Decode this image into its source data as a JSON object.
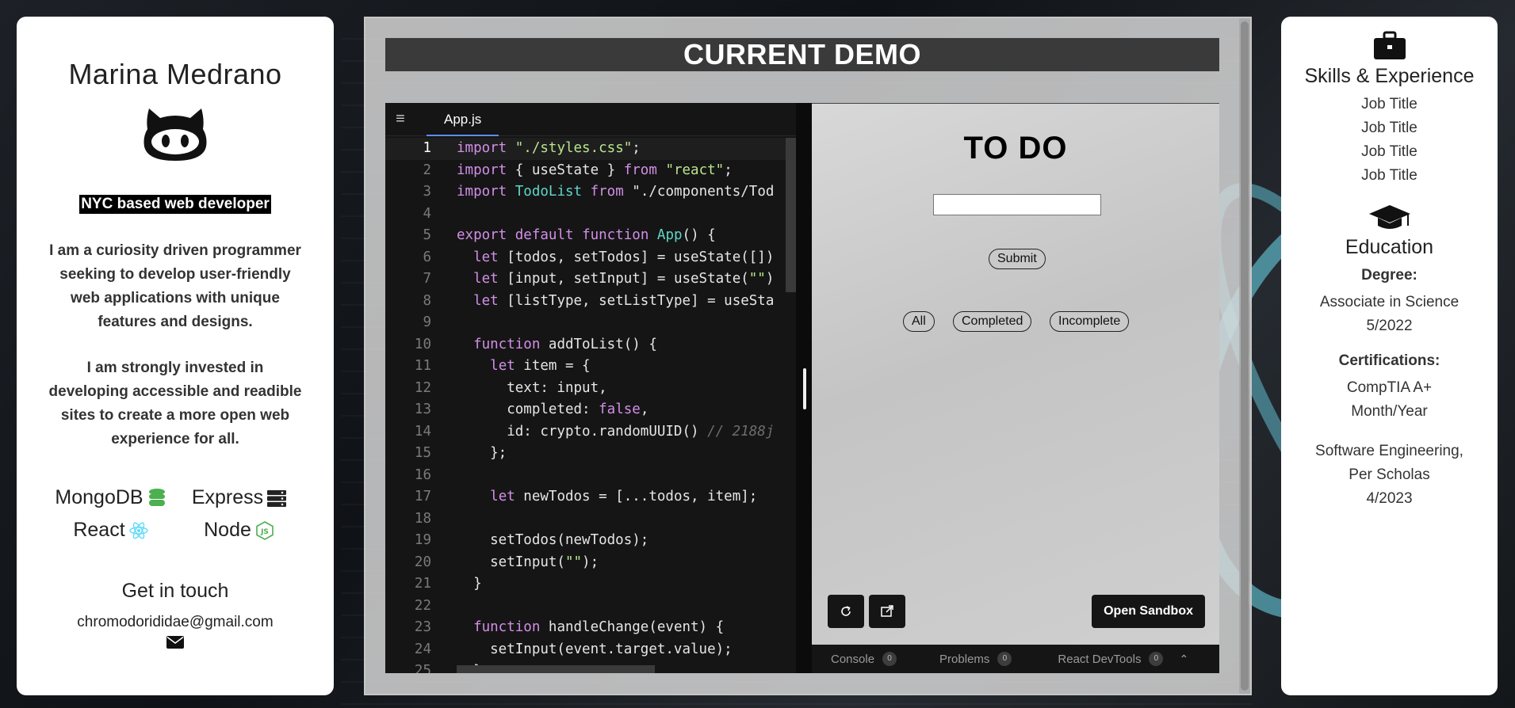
{
  "profile": {
    "name": "Marina Medrano",
    "tagline": "NYC based web developer",
    "bio_1": "I am a curiosity driven programmer seeking to develop user-friendly web applications with unique features and designs.",
    "bio_2": "I am strongly invested in developing accessible and readible sites to create a more open web experience for all.",
    "tech": [
      {
        "label": "MongoDB",
        "icon": "database-icon",
        "color": "#4caf50"
      },
      {
        "label": "Express",
        "icon": "server-icon",
        "color": "#222222"
      },
      {
        "label": "React",
        "icon": "react-icon",
        "color": "#61dafb"
      },
      {
        "label": "Node",
        "icon": "nodejs-icon",
        "color": "#4caf50"
      }
    ],
    "contact_heading": "Get in touch",
    "email": "chromodorididae@gmail.com"
  },
  "demo": {
    "title": "CURRENT DEMO",
    "tab_label": "App.js",
    "code_lines": [
      {
        "n": "1",
        "t": "import \"./styles.css\";"
      },
      {
        "n": "2",
        "t": "import { useState } from \"react\";"
      },
      {
        "n": "3",
        "t": "import TodoList from \"./components/Tod"
      },
      {
        "n": "4",
        "t": ""
      },
      {
        "n": "5",
        "t": "export default function App() {"
      },
      {
        "n": "6",
        "t": "  let [todos, setTodos] = useState([])"
      },
      {
        "n": "7",
        "t": "  let [input, setInput] = useState(\"\")"
      },
      {
        "n": "8",
        "t": "  let [listType, setListType] = useSta"
      },
      {
        "n": "9",
        "t": ""
      },
      {
        "n": "10",
        "t": "  function addToList() {"
      },
      {
        "n": "11",
        "t": "    let item = {"
      },
      {
        "n": "12",
        "t": "      text: input,"
      },
      {
        "n": "13",
        "t": "      completed: false,"
      },
      {
        "n": "14",
        "t": "      id: crypto.randomUUID() // 2188j"
      },
      {
        "n": "15",
        "t": "    };"
      },
      {
        "n": "16",
        "t": ""
      },
      {
        "n": "17",
        "t": "    let newTodos = [...todos, item];"
      },
      {
        "n": "18",
        "t": ""
      },
      {
        "n": "19",
        "t": "    setTodos(newTodos);"
      },
      {
        "n": "20",
        "t": "    setInput(\"\");"
      },
      {
        "n": "21",
        "t": "  }"
      },
      {
        "n": "22",
        "t": ""
      },
      {
        "n": "23",
        "t": "  function handleChange(event) {"
      },
      {
        "n": "24",
        "t": "    setInput(event.target.value);"
      },
      {
        "n": "25",
        "t": "  }"
      }
    ],
    "preview": {
      "title": "TO DO",
      "input_value": "",
      "submit_label": "Submit",
      "filters": [
        "All",
        "Completed",
        "Incomplete"
      ],
      "open_sandbox_label": "Open Sandbox"
    },
    "devtools": {
      "console_label": "Console",
      "console_count": "0",
      "problems_label": "Problems",
      "problems_count": "0",
      "react_label": "React DevTools",
      "react_count": "0"
    }
  },
  "resume": {
    "skills_heading": "Skills & Experience",
    "jobs": [
      "Job Title",
      "Job Title",
      "Job Title",
      "Job Title"
    ],
    "education_heading": "Education",
    "degree_label": "Degree:",
    "degree": "Associate in Science",
    "degree_date": "5/2022",
    "cert_label": "Certifications:",
    "cert_1": "CompTIA A+",
    "cert_1_date": "Month/Year",
    "cert_2_line1": "Software Engineering,",
    "cert_2_line2": "Per Scholas",
    "cert_2_date": "4/2023"
  }
}
